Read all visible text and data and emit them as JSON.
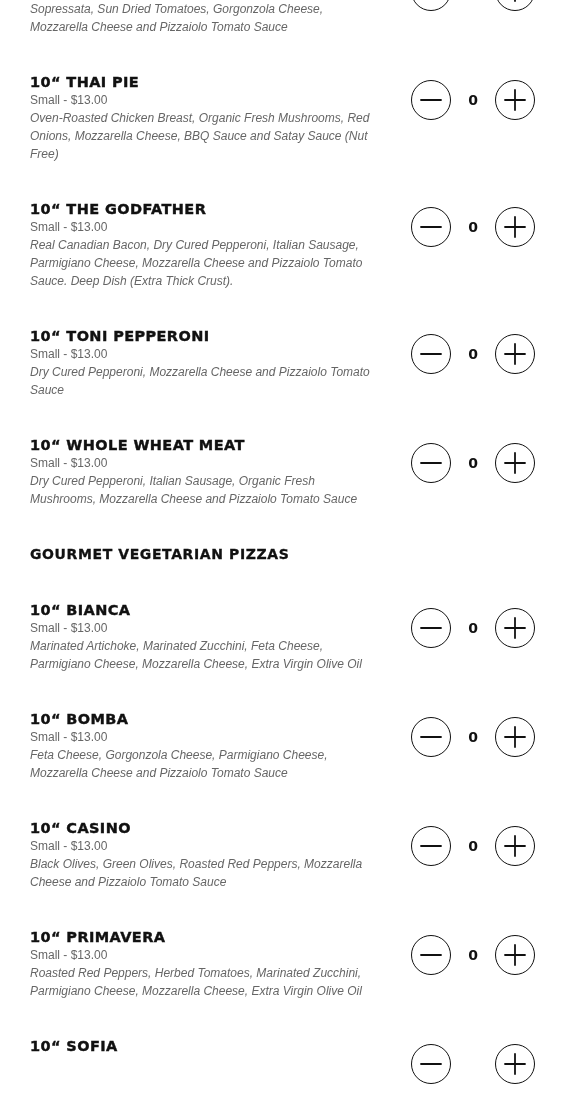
{
  "sections": [
    {
      "items": [
        {
          "description": "Sopressata, Sun Dried Tomatoes, Gorgonzola Cheese, Mozzarella Cheese and Pizzaiolo Tomato Sauce"
        }
      ]
    },
    {
      "items": [
        {
          "name": "10“ THAI PIE",
          "price": "Small - $13.00",
          "description": "Oven-Roasted Chicken Breast, Organic Fresh Mushrooms, Red Onions, Mozzarella Cheese, BBQ Sauce and Satay Sauce (Nut Free)",
          "quantity": "0"
        },
        {
          "name": "10“ THE GODFATHER",
          "price": "Small - $13.00",
          "description": "Real Canadian Bacon, Dry Cured Pepperoni, Italian Sausage, Parmigiano Cheese, Mozzarella Cheese and Pizzaiolo Tomato Sauce. Deep Dish (Extra Thick Crust).",
          "quantity": "0"
        },
        {
          "name": "10“ TONI PEPPERONI",
          "price": "Small - $13.00",
          "description": "Dry Cured Pepperoni, Mozzarella Cheese and Pizzaiolo Tomato Sauce",
          "quantity": "0"
        },
        {
          "name": "10“ WHOLE WHEAT MEAT",
          "price": "Small - $13.00",
          "description": "Dry Cured Pepperoni, Italian Sausage, Organic Fresh Mushrooms, Mozzarella Cheese and Pizzaiolo Tomato Sauce",
          "quantity": "0"
        }
      ]
    },
    {
      "title": "GOURMET VEGETARIAN PIZZAS",
      "items": [
        {
          "name": "10“ BIANCA",
          "price": "Small - $13.00",
          "description": "Marinated Artichoke, Marinated Zucchini, Feta Cheese, Parmigiano Cheese, Mozzarella Cheese, Extra Virgin Olive Oil",
          "quantity": "0"
        },
        {
          "name": "10“ BOMBA",
          "price": "Small - $13.00",
          "description": "Feta Cheese, Gorgonzola Cheese, Parmigiano Cheese, Mozzarella Cheese and Pizzaiolo Tomato Sauce",
          "quantity": "0"
        },
        {
          "name": "10“ CASINO",
          "price": "Small - $13.00",
          "description": "Black Olives, Green Olives, Roasted Red Peppers, Mozzarella Cheese and Pizzaiolo Tomato Sauce",
          "quantity": "0"
        },
        {
          "name": "10“ PRIMAVERA",
          "price": "Small - $13.00",
          "description": "Roasted Red Peppers, Herbed Tomatoes, Marinated Zucchini, Parmigiano Cheese, Mozzarella Cheese, Extra Virgin Olive Oil",
          "quantity": "0"
        },
        {
          "name": "10“ SOFIA"
        }
      ]
    }
  ]
}
